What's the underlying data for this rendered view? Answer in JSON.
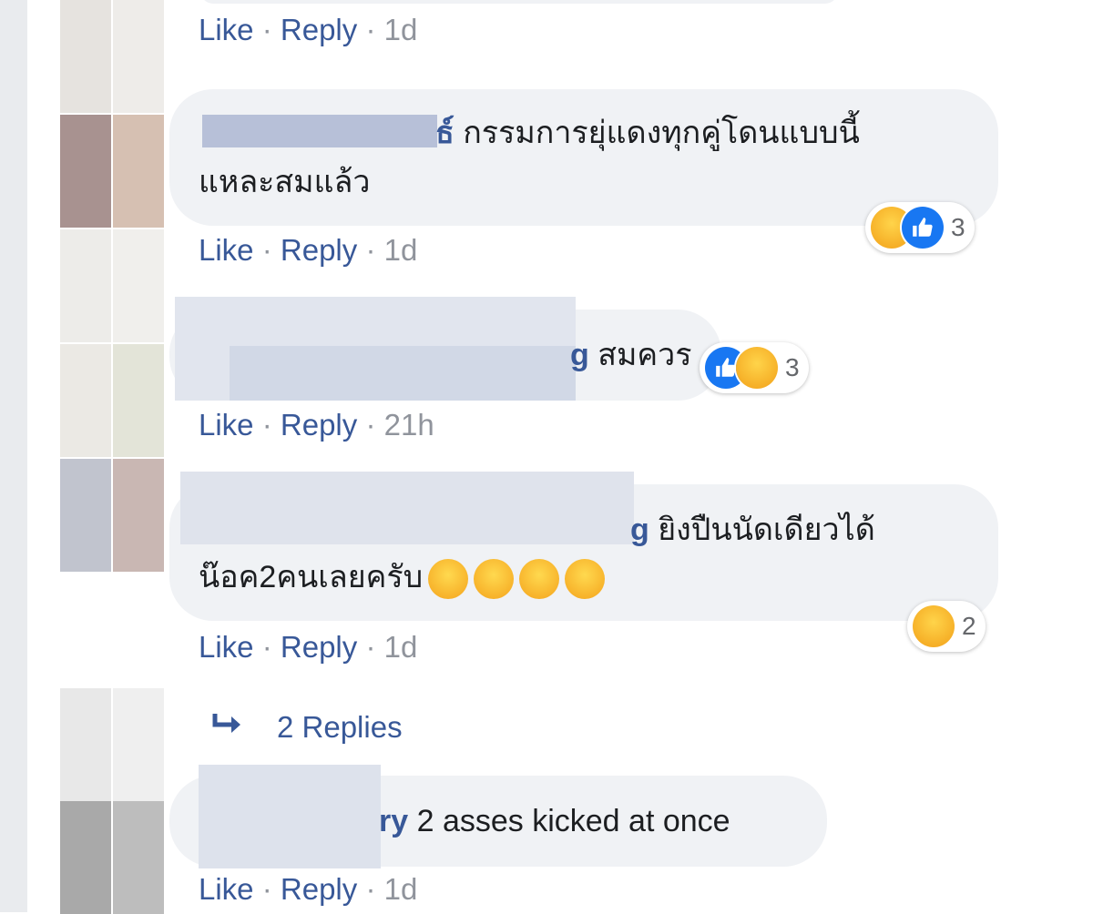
{
  "actions": {
    "like": "Like",
    "reply": "Reply",
    "sep": "·"
  },
  "comments": [
    {
      "time": "1d"
    },
    {
      "author_visible": "ธ์",
      "text_line1": "กรรมการยุ่แดงทุกคู่โดนแบบนี้",
      "text_line2": "แหละสมแล้ว",
      "reaction_count": "3",
      "reaction_icons": [
        "haha",
        "like"
      ],
      "time": "1d"
    },
    {
      "author_visible": "g",
      "text_line1": "สมควร",
      "reaction_count": "3",
      "reaction_icons": [
        "like",
        "haha"
      ],
      "time": "21h"
    },
    {
      "author_visible": "g",
      "text_line1": "ยิงปืนนัดเดียวได้",
      "text_line2": "น๊อค2คนเลยครับ",
      "emoji_icons": [
        "grin",
        "grin",
        "grin",
        "grin"
      ],
      "reaction_count": "2",
      "reaction_icons": [
        "haha"
      ],
      "time": "1d"
    },
    {
      "author_visible": "ry",
      "text_line1": "2 asses kicked at once",
      "time": "1d"
    }
  ],
  "replies_link": {
    "icon": "reply-arrow-icon",
    "label": "2 Replies"
  },
  "colors": {
    "link": "#385898",
    "meta": "#90949c",
    "bubble": "#f0f2f5",
    "like_blue": "#1877f2",
    "haha_yellow": "#f7b125"
  }
}
